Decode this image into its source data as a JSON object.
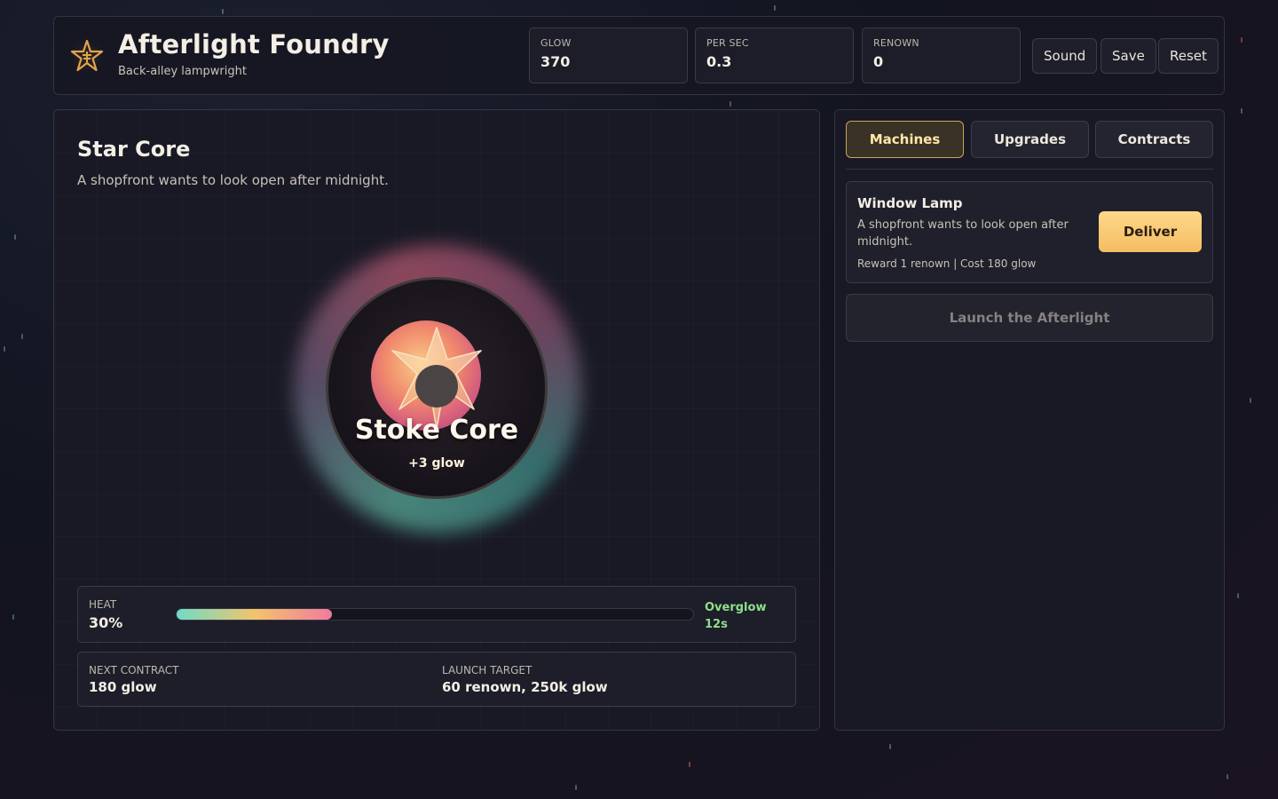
{
  "header": {
    "title": "Afterlight Foundry",
    "subtitle": "Back-alley lampwright",
    "stats": [
      {
        "label": "GLOW",
        "value": "370"
      },
      {
        "label": "PER SEC",
        "value": "0.3"
      },
      {
        "label": "RENOWN",
        "value": "0"
      }
    ],
    "buttons": {
      "sound": "Sound",
      "save": "Save",
      "reset": "Reset"
    }
  },
  "core_panel": {
    "title": "Star Core",
    "description": "A shopfront wants to look open after midnight.",
    "core_button": "Stoke Core",
    "core_gain": "+3 glow",
    "heat": {
      "label": "HEAT",
      "value": "30%",
      "fraction": 0.3,
      "status_line1": "Overglow",
      "status_line2": "12s"
    },
    "info": {
      "next_contract_label": "NEXT CONTRACT",
      "next_contract_value": "180 glow",
      "launch_target_label": "LAUNCH TARGET",
      "launch_target_value": "60 renown, 250k glow"
    }
  },
  "side_panel": {
    "tabs": [
      {
        "label": "Machines",
        "active": true
      },
      {
        "label": "Upgrades",
        "active": false
      },
      {
        "label": "Contracts",
        "active": false
      }
    ],
    "contract": {
      "name": "Window Lamp",
      "description": "A shopfront wants to look open after midnight.",
      "meta": "Reward 1 renown | Cost 180 glow",
      "action": "Deliver"
    },
    "launch_button": "Launch the Afterlight"
  },
  "colors": {
    "accent": "#f3bd62",
    "heat_ok": "#8fe08a",
    "active_tab_border": "#c9a25b"
  },
  "icons": {
    "logo": "star-logo-icon",
    "core": "star-burst-icon"
  }
}
